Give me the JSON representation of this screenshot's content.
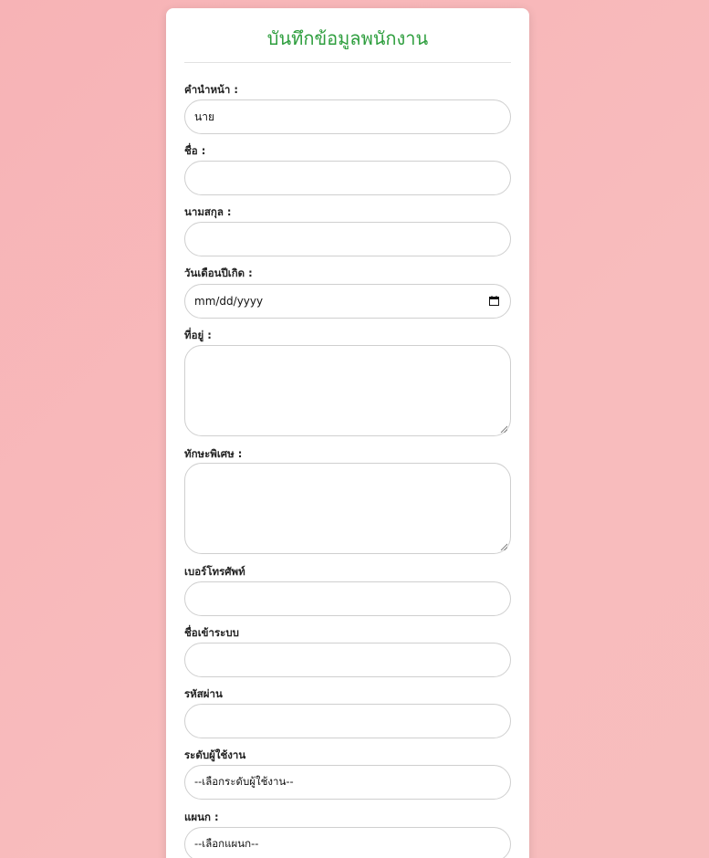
{
  "form": {
    "title": "บันทึกข้อมูลพนักงาน",
    "fields": {
      "prefix": {
        "label": "คำนำหน้า :",
        "value": "นาย"
      },
      "firstname": {
        "label": "ชื่อ :",
        "value": ""
      },
      "lastname": {
        "label": "นามสกุล :",
        "value": ""
      },
      "birthdate": {
        "label": "วันเดือนปีเกิด :",
        "placeholder": "mm/dd/yyyy"
      },
      "address": {
        "label": "ที่อยู่ :",
        "value": ""
      },
      "skills": {
        "label": "ทักษะพิเศษ :",
        "value": ""
      },
      "phone": {
        "label": "เบอร์โทรศัพท์",
        "value": ""
      },
      "username": {
        "label": "ชื่อเข้าระบบ",
        "value": ""
      },
      "password": {
        "label": "รหัสผ่าน",
        "value": ""
      },
      "user_level": {
        "label": "ระดับผู้ใช้งาน",
        "selected": "--เลือกระดับผู้ใช้งาน--"
      },
      "department": {
        "label": "แผนก :",
        "selected": "--เลือกแผนก--"
      }
    }
  },
  "colors": {
    "background": "#f7b9ba",
    "title": "#2e9e3e",
    "card": "#ffffff",
    "border": "#cfcfcf"
  }
}
